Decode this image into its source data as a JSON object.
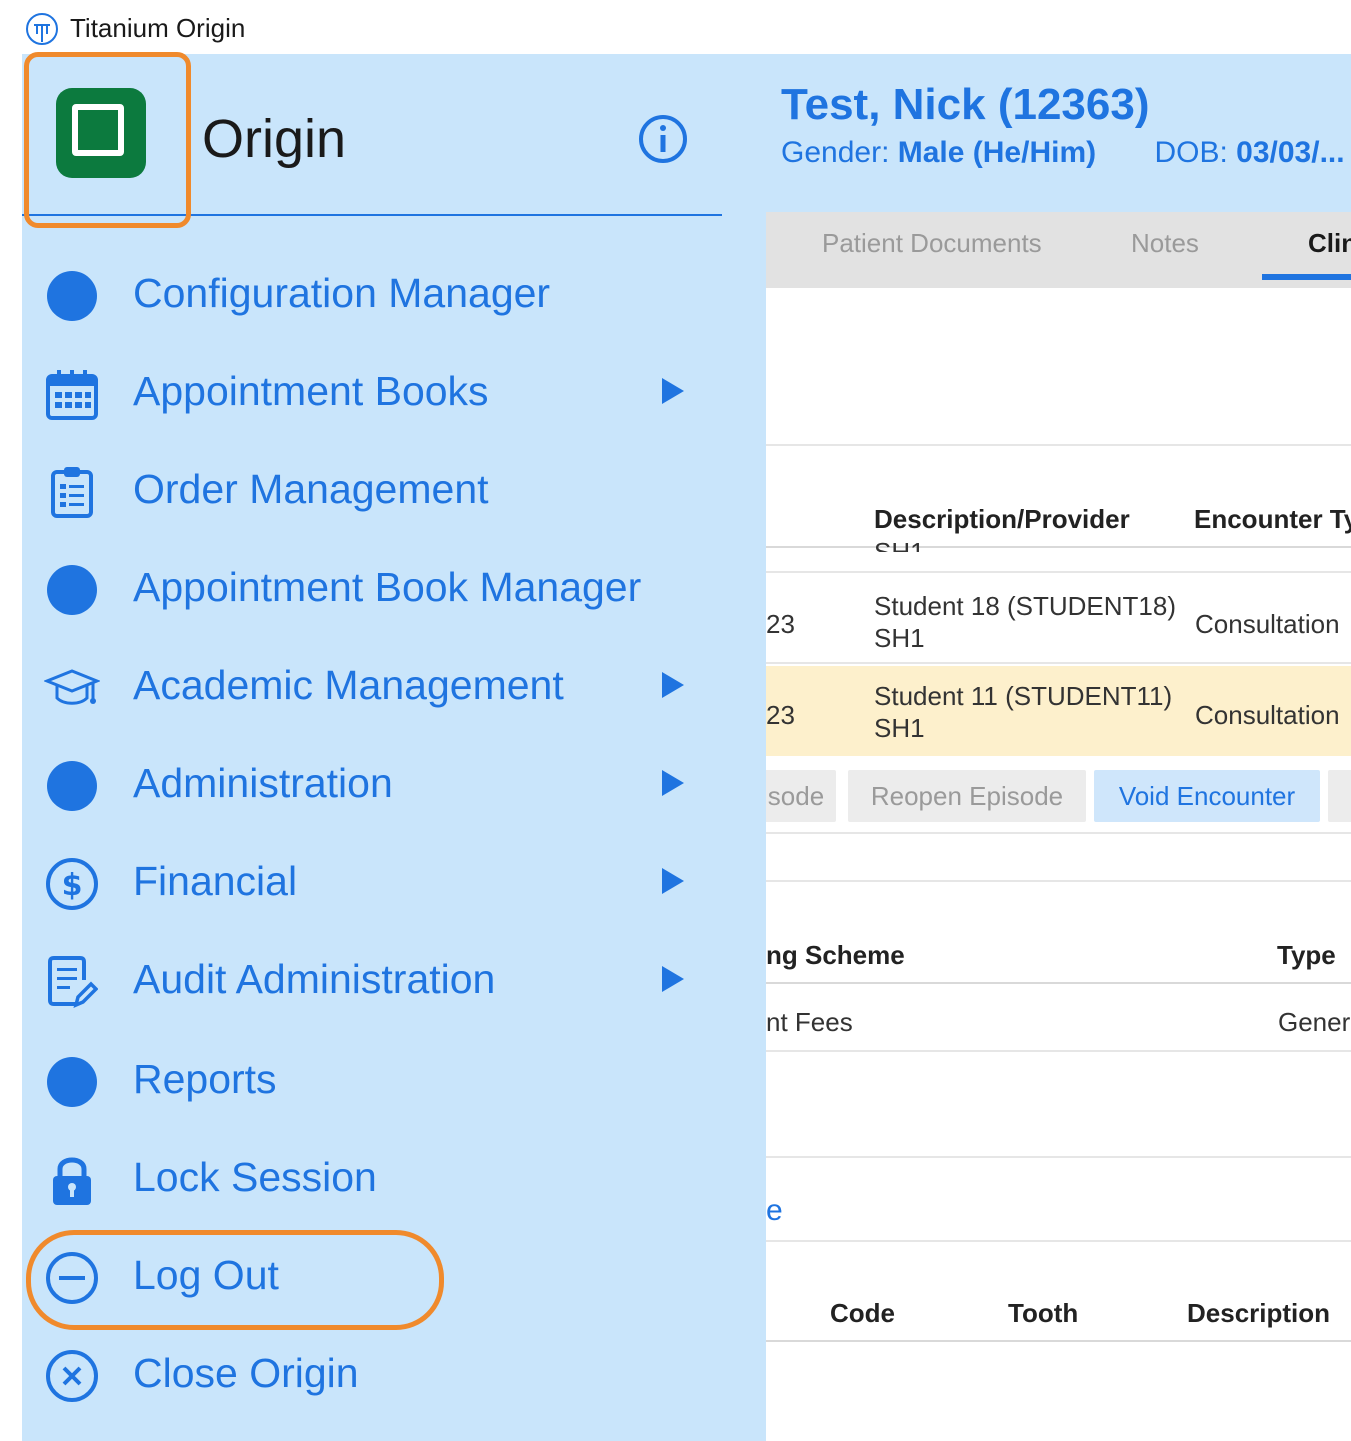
{
  "window": {
    "title": "Titanium Origin",
    "app_icon": "titanium-origin-logo-icon"
  },
  "patient": {
    "name": "Test, Nick (12363)",
    "gender_label": "Gender:",
    "gender_value": "Male (He/Him)",
    "dob_label": "DOB:",
    "dob_value": "03/03/..."
  },
  "tabs": [
    {
      "label": "Patient Documents"
    },
    {
      "label": "Notes"
    },
    {
      "label": "Clin"
    }
  ],
  "encounters": {
    "headers": {
      "description": "Description/Provider",
      "encounter_type": "Encounter Ty"
    },
    "partial_row_text": "SH1",
    "rows": [
      {
        "date_fragment": "23",
        "provider": "Student 18 (STUDENT18)",
        "site": "SH1",
        "type": "Consultation"
      },
      {
        "date_fragment": "23",
        "provider": "Student 11 (STUDENT11)",
        "site": "SH1",
        "type": "Consultation"
      }
    ],
    "actions": {
      "close_fragment": "sode",
      "reopen": "Reopen Episode",
      "void": "Void Encounter"
    }
  },
  "fee_scheme": {
    "headers": {
      "scheme": "ng Scheme",
      "type": "Type"
    },
    "row": {
      "scheme": "nt Fees",
      "type": "Genera"
    }
  },
  "link_fragment": "e",
  "procedures": {
    "headers": {
      "code": "Code",
      "tooth": "Tooth",
      "description": "Description"
    }
  },
  "drawer": {
    "title": "Origin",
    "info_icon": "info-icon",
    "items": [
      {
        "label": "Configuration Manager",
        "icon": "dot-icon",
        "submenu": false
      },
      {
        "label": "Appointment Books",
        "icon": "calendar-icon",
        "submenu": true
      },
      {
        "label": "Order Management",
        "icon": "clipboard-icon",
        "submenu": false
      },
      {
        "label": "Appointment Book Manager",
        "icon": "dot-icon",
        "submenu": false
      },
      {
        "label": "Academic Management",
        "icon": "graduation-cap-icon",
        "submenu": true
      },
      {
        "label": "Administration",
        "icon": "dot-icon",
        "submenu": true
      },
      {
        "label": "Financial",
        "icon": "dollar-circle-icon",
        "submenu": true
      },
      {
        "label": "Audit Administration",
        "icon": "document-edit-icon",
        "submenu": true
      },
      {
        "label": "Reports",
        "icon": "dot-icon",
        "submenu": false
      },
      {
        "label": "Lock Session",
        "icon": "lock-icon",
        "submenu": false
      },
      {
        "label": "Log Out",
        "icon": "minus-circle-icon",
        "submenu": false
      },
      {
        "label": "Close Origin",
        "icon": "close-circle-icon",
        "submenu": false
      }
    ]
  },
  "colors": {
    "accent": "#1f74e0",
    "drawer_bg": "#c9e5fb",
    "logo_green": "#0c7a3e",
    "highlight_outline": "#f08a2c",
    "selected_row": "#fdf0cc"
  }
}
